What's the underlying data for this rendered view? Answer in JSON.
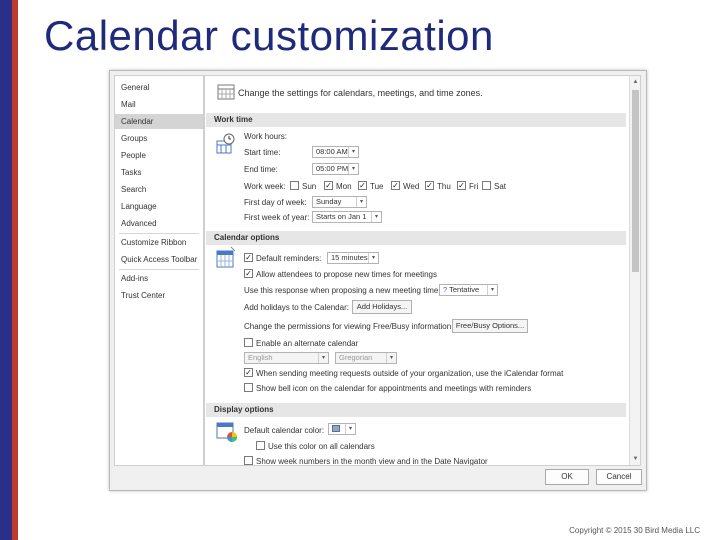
{
  "slide": {
    "title": "Calendar customization",
    "copyright": "Copyright © 2015 30 Bird Media LLC"
  },
  "nav": {
    "items": [
      "General",
      "Mail",
      "Calendar",
      "Groups",
      "People",
      "Tasks",
      "Search",
      "Language",
      "Advanced",
      "Customize Ribbon",
      "Quick Access Toolbar",
      "Add-ins",
      "Trust Center"
    ],
    "active": "Calendar"
  },
  "content": {
    "header": "Change the settings for calendars, meetings, and time zones.",
    "work_time": {
      "section": "Work time",
      "work_hours_label": "Work hours:",
      "start_time_label": "Start time:",
      "start_time_value": "08:00 AM",
      "end_time_label": "End time:",
      "end_time_value": "05:00 PM",
      "work_week_label": "Work week:",
      "days": [
        {
          "label": "Sun",
          "checked": false
        },
        {
          "label": "Mon",
          "checked": true
        },
        {
          "label": "Tue",
          "checked": true
        },
        {
          "label": "Wed",
          "checked": true
        },
        {
          "label": "Thu",
          "checked": true
        },
        {
          "label": "Fri",
          "checked": true
        },
        {
          "label": "Sat",
          "checked": false
        }
      ],
      "first_day_label": "First day of week:",
      "first_day_value": "Sunday",
      "first_week_label": "First week of year:",
      "first_week_value": "Starts on Jan 1"
    },
    "calendar_options": {
      "section": "Calendar options",
      "default_reminders_label": "Default reminders:",
      "default_reminders_value": "15 minutes",
      "allow_propose_label": "Allow attendees to propose new times for meetings",
      "use_response_label": "Use this response when proposing a new meeting time:",
      "response_value": "Tentative",
      "response_icon": "?",
      "add_holidays_label": "Add holidays to the Calendar:",
      "add_holidays_button": "Add Holidays...",
      "permissions_label": "Change the permissions for viewing Free/Busy information:",
      "free_busy_button": "Free/Busy Options...",
      "alt_calendar_label": "Enable an alternate calendar",
      "alt_language_value": "English",
      "alt_type_value": "Gregorian",
      "icalendar_label": "When sending meeting requests outside of your organization, use the iCalendar format",
      "bell_label": "Show bell icon on the calendar for appointments and meetings with reminders"
    },
    "display_options": {
      "section": "Display options",
      "default_color_label": "Default calendar color:",
      "use_color_label": "Use this color on all calendars",
      "week_numbers_label": "Show week numbers in the month view and in the Date Navigator"
    }
  },
  "footer": {
    "ok": "OK",
    "cancel": "Cancel"
  },
  "colors": {
    "title": "#1f2a7a",
    "left_bar": "#2b2f8a",
    "left_stripe": "#c0392b",
    "nav_active": "#d4d4d4",
    "section_bar": "#e6e6e6"
  }
}
